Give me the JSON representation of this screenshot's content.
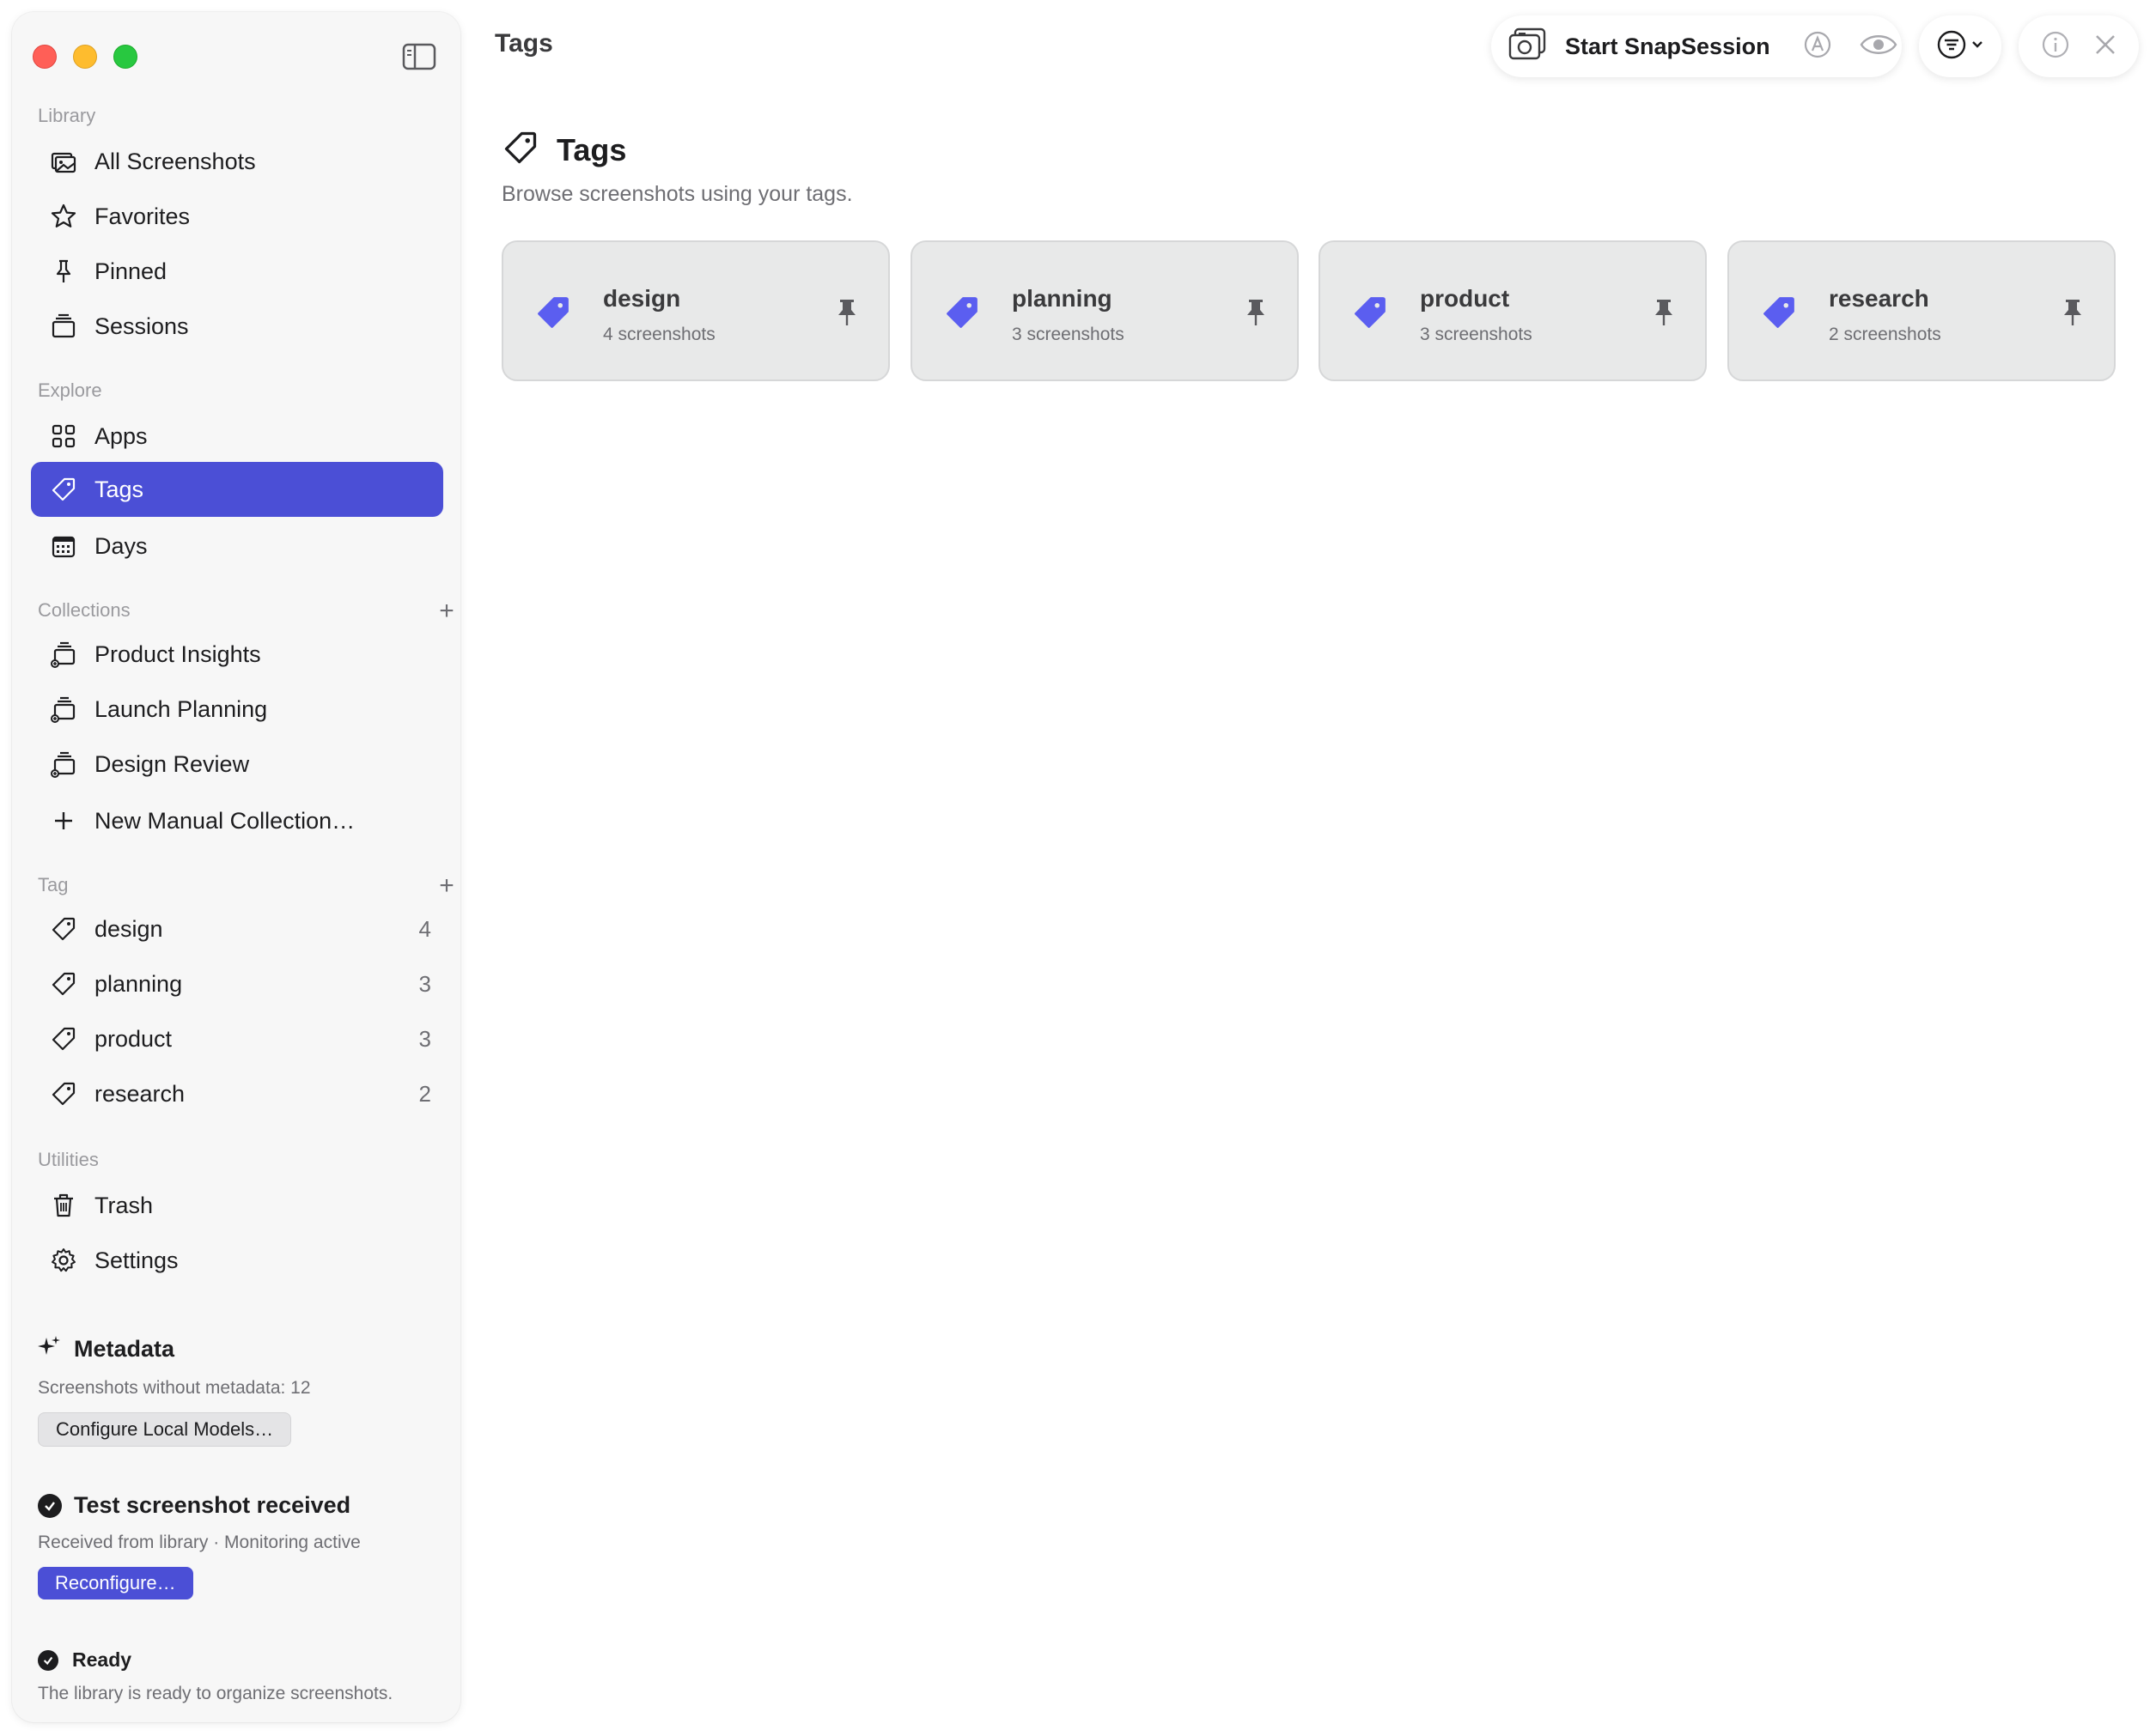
{
  "window": {
    "title": "Tags"
  },
  "sidebar": {
    "sections": {
      "library": "Library",
      "explore": "Explore",
      "collections": "Collections",
      "tag": "Tag",
      "utilities": "Utilities"
    },
    "library_items": [
      {
        "label": "All Screenshots",
        "icon": "photos-icon"
      },
      {
        "label": "Favorites",
        "icon": "star-icon"
      },
      {
        "label": "Pinned",
        "icon": "pin-icon"
      },
      {
        "label": "Sessions",
        "icon": "stack-icon"
      }
    ],
    "explore_items": [
      {
        "label": "Apps",
        "icon": "grid-icon"
      },
      {
        "label": "Tags",
        "icon": "tag-icon",
        "selected": true
      },
      {
        "label": "Days",
        "icon": "calendar-icon"
      }
    ],
    "collection_items": [
      {
        "label": "Product Insights",
        "icon": "collection-icon"
      },
      {
        "label": "Launch Planning",
        "icon": "collection-icon"
      },
      {
        "label": "Design Review",
        "icon": "collection-icon"
      },
      {
        "label": "New Manual Collection…",
        "icon": "plus-icon"
      }
    ],
    "tag_items": [
      {
        "label": "design",
        "count": "4"
      },
      {
        "label": "planning",
        "count": "3"
      },
      {
        "label": "product",
        "count": "3"
      },
      {
        "label": "research",
        "count": "2"
      }
    ],
    "utility_items": [
      {
        "label": "Trash",
        "icon": "trash-icon"
      },
      {
        "label": "Settings",
        "icon": "gear-icon"
      }
    ],
    "metadata": {
      "title": "Metadata",
      "subtitle": "Screenshots without metadata: 12",
      "button": "Configure Local Models…"
    },
    "test_status": {
      "title": "Test screenshot received",
      "subtitle": "Received from library · Monitoring active",
      "button": "Reconfigure…"
    },
    "ready": {
      "title": "Ready",
      "subtitle": "The library is ready to organize screenshots."
    }
  },
  "toolbar": {
    "session_label": "Start SnapSession"
  },
  "main": {
    "heading": "Tags",
    "subtitle": "Browse screenshots using your tags.",
    "cards": [
      {
        "name": "design",
        "count": "4 screenshots"
      },
      {
        "name": "planning",
        "count": "3 screenshots"
      },
      {
        "name": "product",
        "count": "3 screenshots"
      },
      {
        "name": "research",
        "count": "2 screenshots"
      }
    ]
  },
  "colors": {
    "accent": "#4b4fd6",
    "tag_icon": "#5b5ef0",
    "card_bg": "#e8e9e9",
    "sidebar_bg": "#f7f7f7"
  }
}
